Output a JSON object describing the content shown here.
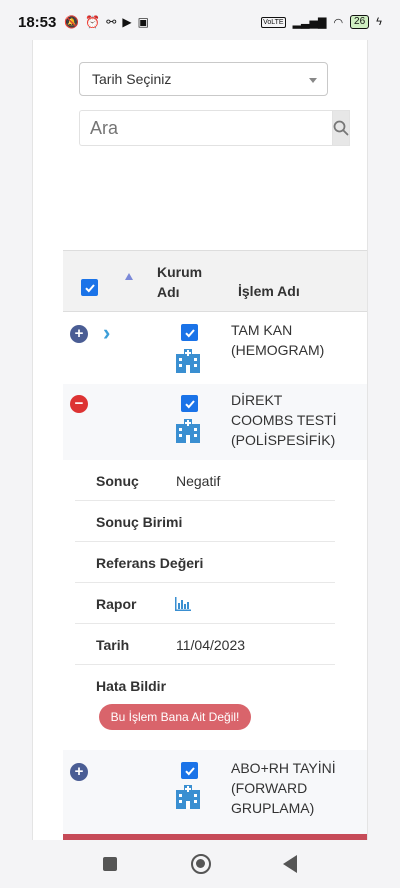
{
  "status_bar": {
    "time": "18:53",
    "battery": "26",
    "network_label": "VoLTE"
  },
  "filters": {
    "date_select_value": "Tarih Seçiniz",
    "search_placeholder": "Ara"
  },
  "table": {
    "header_kurum_line1": "Kurum",
    "header_kurum_line2": "Adı",
    "header_islem": "İşlem Adı",
    "rows": [
      {
        "proc_line1": "TAM KAN",
        "proc_line2": "(HEMOGRAM)",
        "proc_line3": "",
        "expanded": false,
        "checked": true
      },
      {
        "proc_line1": "DİREKT",
        "proc_line2": "COOMBS TESTİ",
        "proc_line3": "(POLİSPESİFİK)",
        "expanded": true,
        "checked": true
      },
      {
        "proc_line1": "ABO+RH TAYİNİ",
        "proc_line2": "(FORWARD",
        "proc_line3": "GRUPLAMA)",
        "expanded": false,
        "checked": true
      }
    ]
  },
  "details": {
    "sonuc_label": "Sonuç",
    "sonuc_value": "Negatif",
    "sonuc_birimi_label": "Sonuç Birimi",
    "referans_label": "Referans Değeri",
    "rapor_label": "Rapor",
    "tarih_label": "Tarih",
    "tarih_value": "11/04/2023",
    "hata_label": "Hata Bildir",
    "hata_button": "Bu İşlem Bana Ait Değil!"
  },
  "colors": {
    "accent_blue": "#1a73e8",
    "expand_plus": "#4a5d94",
    "collapse_minus": "#dd3333",
    "error_button": "#d9646b"
  }
}
